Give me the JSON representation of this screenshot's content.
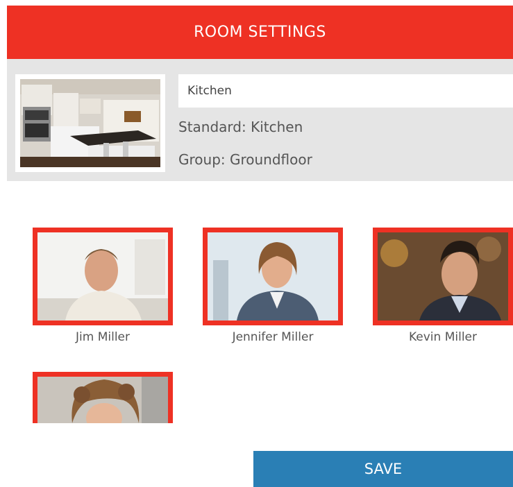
{
  "header": {
    "title": "ROOM SETTINGS"
  },
  "room": {
    "name_value": "Kitchen",
    "standard": "Standard: Kitchen",
    "group": "Group: Groundfloor"
  },
  "people": [
    {
      "name": "Jim Miller"
    },
    {
      "name": "Jennifer Miller"
    },
    {
      "name": "Kevin Miller"
    },
    {
      "name": ""
    }
  ],
  "actions": {
    "save_label": "SAVE"
  },
  "colors": {
    "accent_red": "#ee3124",
    "panel_gray": "#e5e5e5",
    "save_blue": "#2a7fb5"
  }
}
